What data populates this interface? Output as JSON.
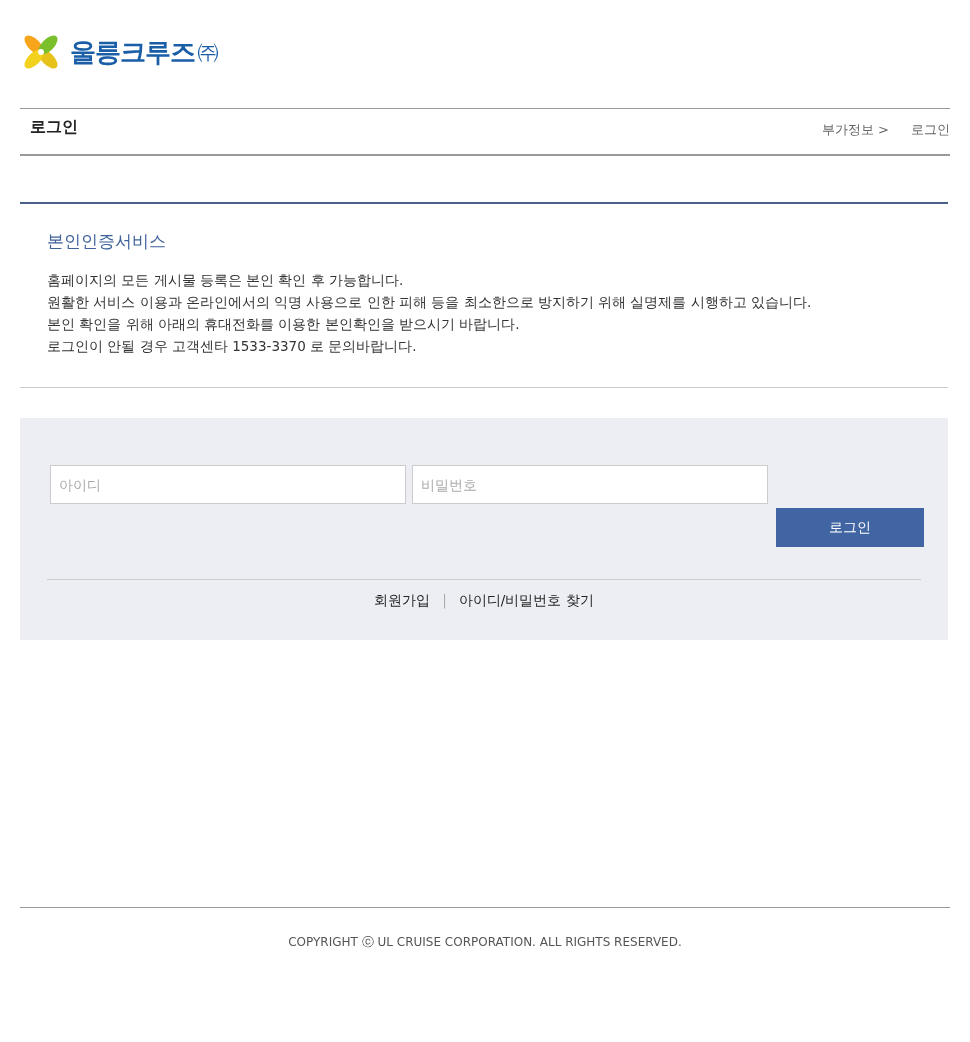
{
  "logo": {
    "text": "울릉크루즈",
    "suffix": "㈜"
  },
  "page_title": "로그인",
  "breadcrumb": [
    {
      "label": "부가정보 >"
    },
    {
      "label": "로그인"
    }
  ],
  "notice": {
    "heading": "본인인증서비스",
    "lines": [
      "홈페이지의 모든 게시물 등록은 본인 확인 후 가능합니다.",
      "원활한 서비스 이용과 온라인에서의 익명 사용으로 인한 피해 등을 최소한으로 방지하기 위해 실명제를 시행하고 있습니다.",
      "본인 확인을 위해 아래의 휴대전화를 이용한 본인확인을 받으시기 바랍니다.",
      "로그인이 안될 경우 고객센타 1533-3370 로 문의바랍니다."
    ]
  },
  "login": {
    "id_placeholder": "아이디",
    "password_placeholder": "비밀번호",
    "button": "로그인",
    "links": [
      {
        "label": "회원가입"
      },
      {
        "label": "아이디/비밀번호 찾기"
      }
    ],
    "separator": "|"
  },
  "footer": {
    "copyright": "COPYRIGHT ⓒ UL CRUISE CORPORATION. ALL RIGHTS RESERVED."
  }
}
